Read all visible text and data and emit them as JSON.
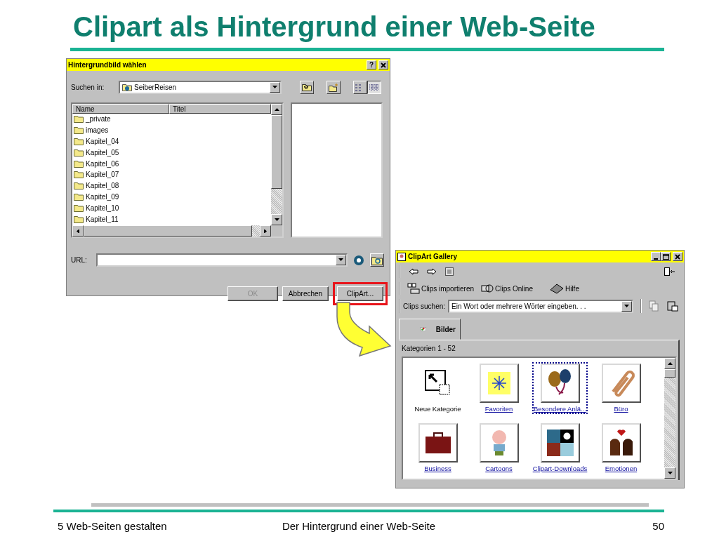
{
  "slide_title": "Clipart als Hintergrund einer Web-Seite",
  "file_dialog": {
    "title": "Hintergrundbild wählen",
    "help_button": "?",
    "look_in_label": "Suchen in:",
    "look_in_value": "SeiberReisen",
    "columns": [
      "Name",
      "Titel"
    ],
    "items": [
      "_private",
      "images",
      "Kapitel_04",
      "Kapitel_05",
      "Kapitel_06",
      "Kapitel_07",
      "Kapitel_08",
      "Kapitel_09",
      "Kapitel_10",
      "Kapitel_11"
    ],
    "url_label": "URL:",
    "buttons": [
      {
        "label": "OK",
        "disabled": true,
        "highlighted": false
      },
      {
        "label": "Abbrechen",
        "disabled": false,
        "highlighted": false
      },
      {
        "label": "ClipArt...",
        "disabled": false,
        "highlighted": true
      }
    ]
  },
  "clipart_gallery": {
    "title": "ClipArt Gallery",
    "toolbar_buttons": [
      "Clips importieren",
      "Clips Online",
      "Hilfe"
    ],
    "search_label": "Clips suchen:",
    "search_value": "Ein Wort oder mehrere Wörter eingeben. . .",
    "tabs": [
      {
        "label": "Bilder",
        "selected": true
      }
    ],
    "range_label": "Kategorien 1 - 52",
    "categories": [
      {
        "label": "Neue Kategorie",
        "kind": "new",
        "selected": false
      },
      {
        "label": "Favoriten",
        "kind": "link",
        "selected": false
      },
      {
        "label": "Besondere Anlä...",
        "kind": "link",
        "selected": true
      },
      {
        "label": "Büro",
        "kind": "link",
        "selected": false
      },
      {
        "label": "Business",
        "kind": "link",
        "selected": false
      },
      {
        "label": "Cartoons",
        "kind": "link",
        "selected": false
      },
      {
        "label": "Clipart-Downloads",
        "kind": "link",
        "selected": false
      },
      {
        "label": "Emotionen",
        "kind": "link",
        "selected": false
      }
    ]
  },
  "footer": {
    "section": "5 Web-Seiten gestalten",
    "topic": "Der Hintergrund einer Web-Seite",
    "page": "50"
  }
}
